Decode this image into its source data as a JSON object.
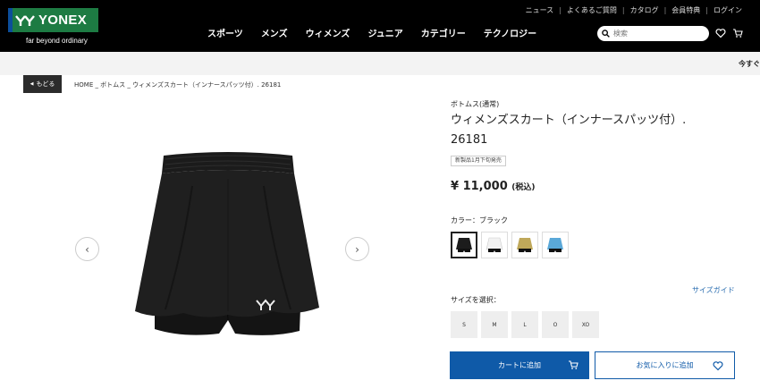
{
  "brand": {
    "logo_text": "YONEX",
    "tagline": "far beyond ordinary",
    "colors": {
      "logo_green": "#1d7b43",
      "logo_blue": "#0c4e9a",
      "header_bg": "#000000"
    }
  },
  "util_nav": [
    "ニュース",
    "よくあるご質問",
    "カタログ",
    "会員特典",
    "ログイン"
  ],
  "main_nav": [
    "スポーツ",
    "メンズ",
    "ウィメンズ",
    "ジュニア",
    "カテゴリー",
    "テクノロジー"
  ],
  "search": {
    "placeholder": "検索"
  },
  "strip": {
    "text": "今すぐ"
  },
  "back_button": {
    "label": "もどる"
  },
  "breadcrumb": "HOME _ ボトムス _ ウィメンズスカート（インナースパッツ付）. 26181",
  "product": {
    "category": "ボトムス(通常)",
    "title_line1": "ウィメンズスカート（インナースパッツ付）.",
    "title_line2": "26181",
    "badge": "新製品1月下旬発売",
    "price": "¥ 11,000",
    "tax_note": "(税込)",
    "color_label": "カラー：ブラック",
    "swatch_colors": [
      "#1c1c1c",
      "#f2f2f2",
      "#bfa85a",
      "#5aa8d8"
    ],
    "size_guide": "サイズガイド",
    "size_label": "サイズを選択：",
    "sizes": [
      "S",
      "M",
      "L",
      "O",
      "XO"
    ],
    "add_to_cart": "カートに追加",
    "add_to_favorite": "お気に入りに追加",
    "accent_color": "#0f5aa8"
  }
}
